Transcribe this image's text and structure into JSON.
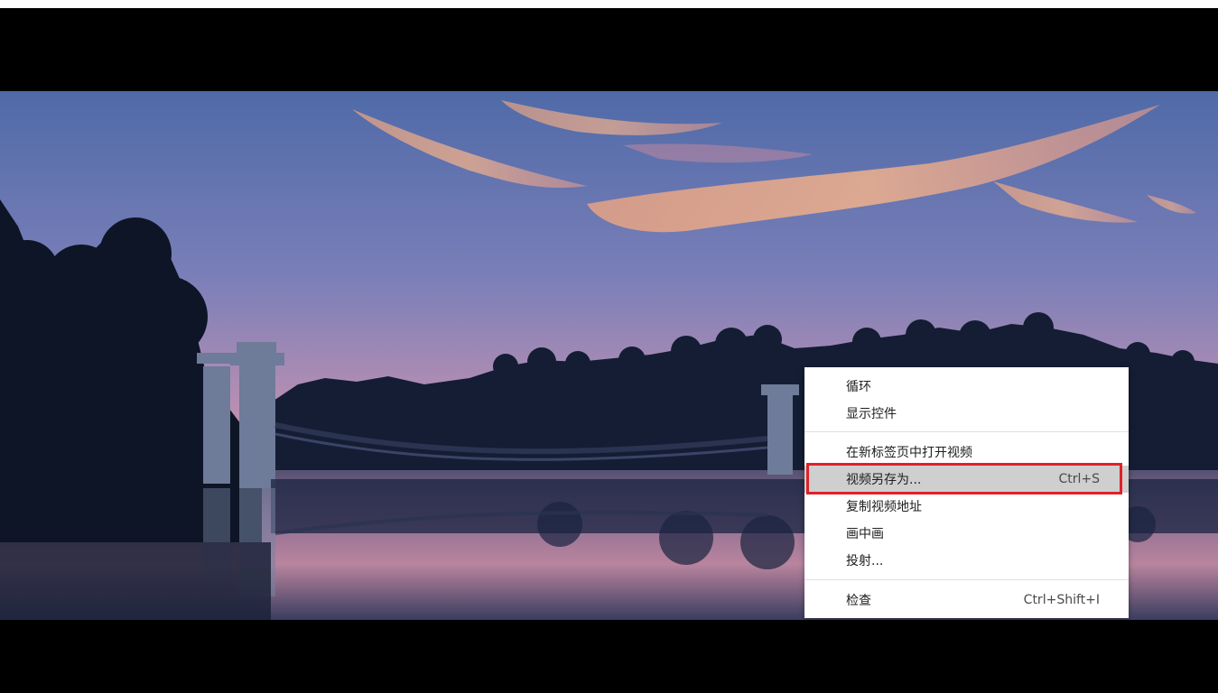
{
  "video": {
    "scene": "sunset-lake-bridge-video-frame"
  },
  "context_menu": {
    "items": [
      {
        "label": "循环",
        "shortcut": ""
      },
      {
        "label": "显示控件",
        "shortcut": ""
      },
      {
        "label": "在新标签页中打开视频",
        "shortcut": ""
      },
      {
        "label": "视频另存为...",
        "shortcut": "Ctrl+S"
      },
      {
        "label": "复制视频地址",
        "shortcut": ""
      },
      {
        "label": "画中画",
        "shortcut": ""
      },
      {
        "label": "投射...",
        "shortcut": ""
      },
      {
        "label": "检查",
        "shortcut": "Ctrl+Shift+I"
      }
    ],
    "highlighted_index": 3
  },
  "colors": {
    "highlight_border": "#e0202a",
    "hover_background": "#cfcfcf",
    "letterbox": "#000000"
  }
}
